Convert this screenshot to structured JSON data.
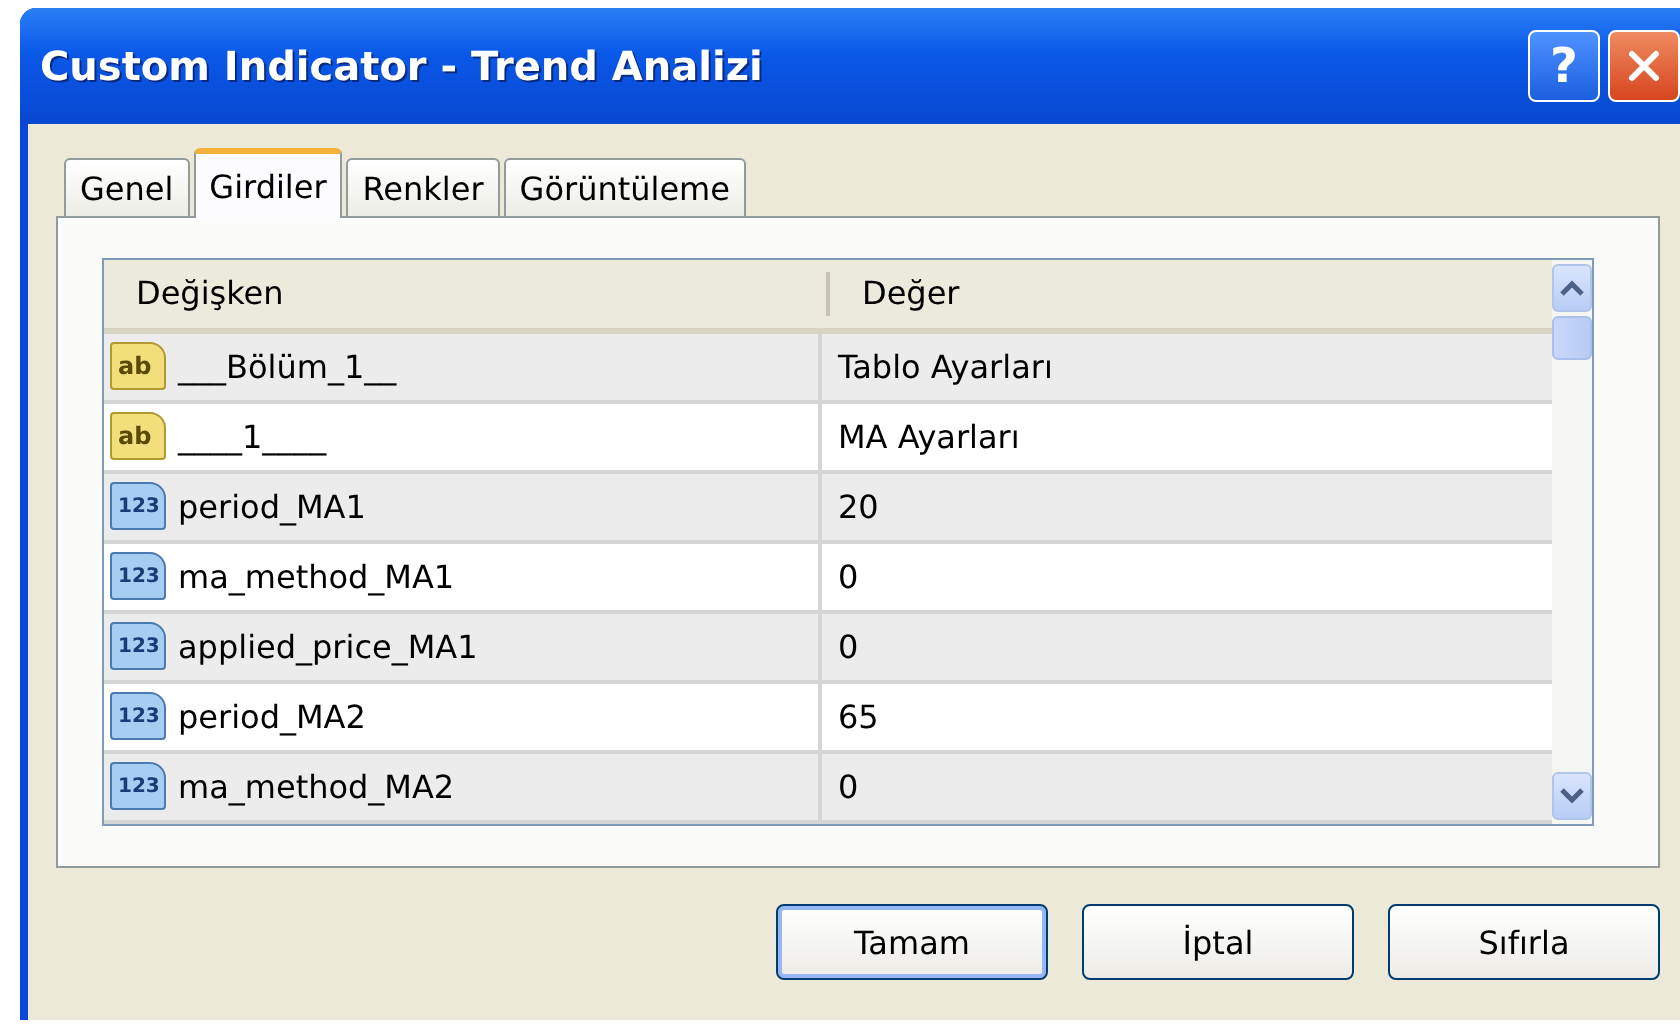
{
  "window": {
    "title": "Custom Indicator - Trend Analizi",
    "help_button": "?"
  },
  "tabs": [
    {
      "label": "Genel",
      "selected": false
    },
    {
      "label": "Girdiler",
      "selected": true
    },
    {
      "label": "Renkler",
      "selected": false
    },
    {
      "label": "Görüntüleme",
      "selected": false
    }
  ],
  "table": {
    "columns": [
      "Değişken",
      "Değer"
    ],
    "rows": [
      {
        "kind": "string",
        "badge": "ab",
        "name": "___Bölüm_1__",
        "value": "Tablo Ayarları"
      },
      {
        "kind": "string",
        "badge": "ab",
        "name": "____1____",
        "value": "MA Ayarları"
      },
      {
        "kind": "number",
        "badge": "123",
        "name": "period_MA1",
        "value": "20"
      },
      {
        "kind": "number",
        "badge": "123",
        "name": "ma_method_MA1",
        "value": "0"
      },
      {
        "kind": "number",
        "badge": "123",
        "name": "applied_price_MA1",
        "value": "0"
      },
      {
        "kind": "number",
        "badge": "123",
        "name": "period_MA2",
        "value": "65"
      },
      {
        "kind": "number",
        "badge": "123",
        "name": "ma_method_MA2",
        "value": "0"
      }
    ]
  },
  "buttons": [
    {
      "label": "Tamam",
      "default": true
    },
    {
      "label": "İptal",
      "default": false
    },
    {
      "label": "Sıfırla",
      "default": false
    }
  ]
}
